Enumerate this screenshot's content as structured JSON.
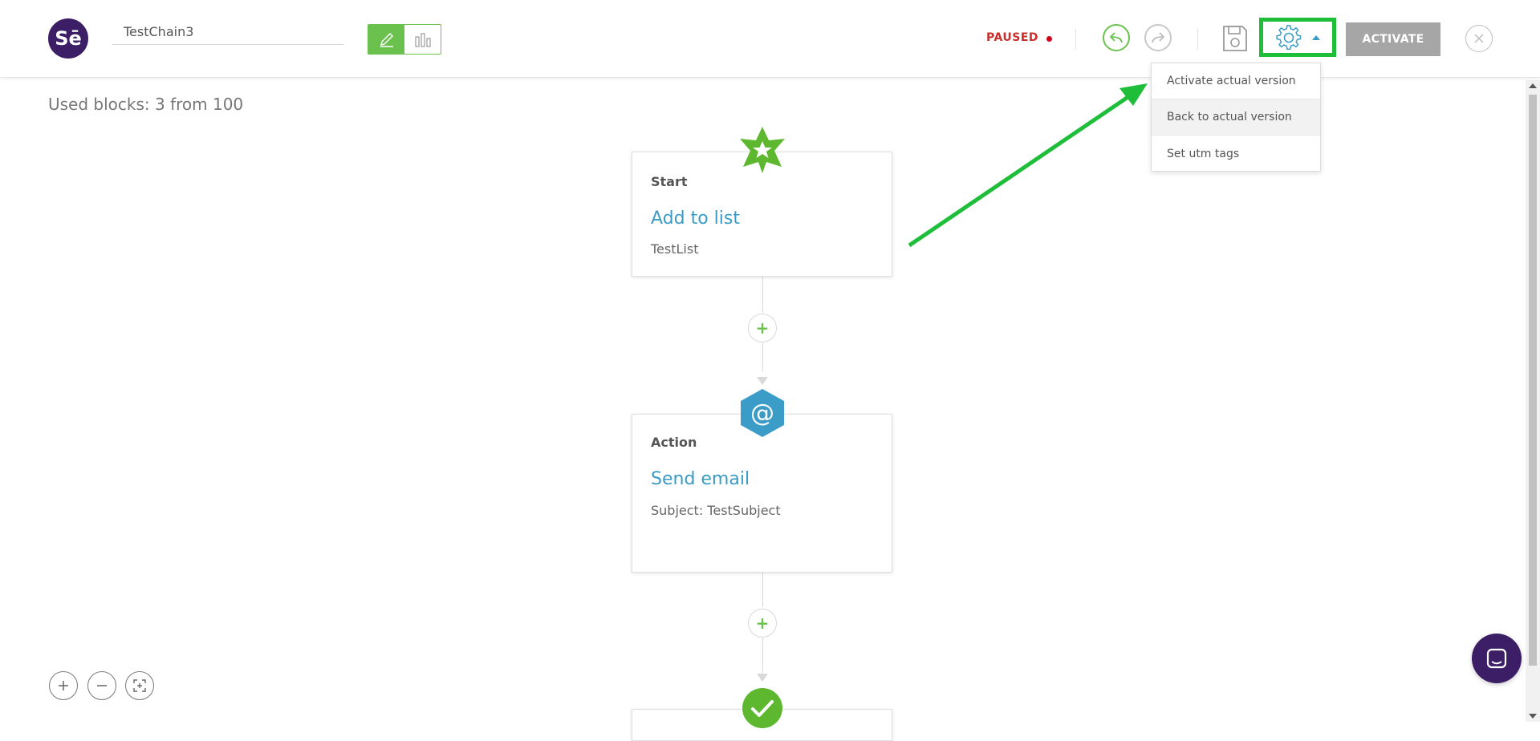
{
  "header": {
    "logo_text": "Sē",
    "chain_name": "TestChain3",
    "status_text": "PAUSED",
    "activate_label": "ACTIVATE",
    "icons": {
      "edit": "pencil-icon",
      "stats": "bar-chart-icon",
      "undo": "undo-icon",
      "redo": "redo-icon",
      "save": "save-icon",
      "settings": "gear-icon",
      "caret": "caret-up-icon",
      "close": "close-icon"
    }
  },
  "settings_menu": {
    "items": [
      {
        "label": "Activate actual version"
      },
      {
        "label": "Back to actual version"
      },
      {
        "label": "Set utm tags"
      }
    ]
  },
  "canvas": {
    "used_blocks": "Used blocks: 3 from 100",
    "blocks": [
      {
        "type": "Start",
        "title": "Add to list",
        "detail": "TestList",
        "icon": "star-icon"
      },
      {
        "type": "Action",
        "title": "Send email",
        "detail": "Subject: TestSubject",
        "icon": "at-sign-icon"
      },
      {
        "icon": "checkmark-icon"
      }
    ],
    "add_symbol": "+"
  },
  "zoom_controls": {
    "icons": [
      "zoom-in-icon",
      "zoom-out-icon",
      "fit-screen-icon"
    ]
  },
  "colors": {
    "brand_purple": "#3b1e66",
    "accent_green": "#6ac14e",
    "highlight_green": "#1fbe3a",
    "link_blue": "#3a9cc4",
    "paused_red": "#c9302c",
    "activate_gray": "#a6a6a6"
  }
}
